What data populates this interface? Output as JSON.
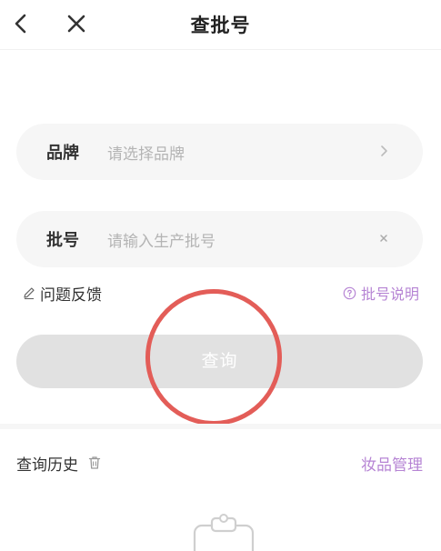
{
  "header": {
    "title": "查批号"
  },
  "brand_field": {
    "label": "品牌",
    "placeholder": "请选择品牌"
  },
  "batch_field": {
    "label": "批号",
    "placeholder": "请输入生产批号"
  },
  "links": {
    "feedback": "问题反馈",
    "explain": "批号说明"
  },
  "query_button": {
    "label": "查询"
  },
  "history": {
    "title": "查询历史",
    "manage": "妆品管理"
  },
  "colors": {
    "accent": "#b684d4",
    "button_disabled": "#e1e1e1",
    "annotation_ring": "#e35d58"
  },
  "icons": [
    "back-arrow-icon",
    "close-icon",
    "chevron-right-icon",
    "clear-icon",
    "edit-pencil-icon",
    "question-circle-icon",
    "trash-icon",
    "clipboard-icon"
  ]
}
